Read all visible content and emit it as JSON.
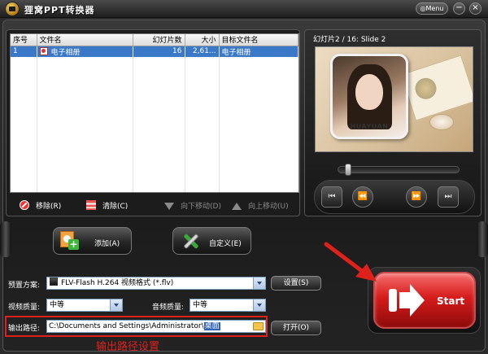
{
  "app": {
    "title": "狸窝PPT转换器"
  },
  "window_controls": {
    "menu_label": "Menu",
    "menu_glyph": "◎",
    "minimize": "−",
    "close": "×"
  },
  "file_list": {
    "columns": [
      "序号",
      "文件名",
      "幻灯片数",
      "大小",
      "目标文件名"
    ],
    "rows": [
      {
        "index": "1",
        "file_name": "电子相册",
        "slides": "16",
        "size": "2,61...",
        "target_name": "电子相册"
      }
    ],
    "actions": {
      "remove": "移除(R)",
      "clear": "清除(C)",
      "move_down": "向下移动(D)",
      "move_up": "向上移动(U)"
    }
  },
  "preview": {
    "slide_label": "幻灯片2 / 16: Slide 2",
    "caption": "HUAYUAN",
    "seek_fraction": 0.06,
    "controls": {
      "first": "⏮",
      "prev": "⏪",
      "next": "⏩",
      "last": "⏭"
    }
  },
  "buttons": {
    "add": "添加(A)",
    "customize": "自定义(E)",
    "start": "Start"
  },
  "settings": {
    "preset_label": "预置方案:",
    "preset_value": "FLV-Flash H.264 视频格式 (*.flv)",
    "settings_button": "设置(S)",
    "video_quality_label": "视频质量:",
    "video_quality_value": "中等",
    "audio_quality_label": "音频质量:",
    "audio_quality_value": "中等",
    "output_path_label": "输出路径:",
    "output_path_prefix": "C:\\Documents and Settings\\Administrator\\",
    "output_path_selected": "桌面",
    "open_button": "打开(O)"
  },
  "annotation": {
    "text": "输出路径设置",
    "color": "#e0201a"
  },
  "colors": {
    "selection": "#3a78c8",
    "start_red": "#d61b1b",
    "annotation_red": "#e0201a"
  }
}
